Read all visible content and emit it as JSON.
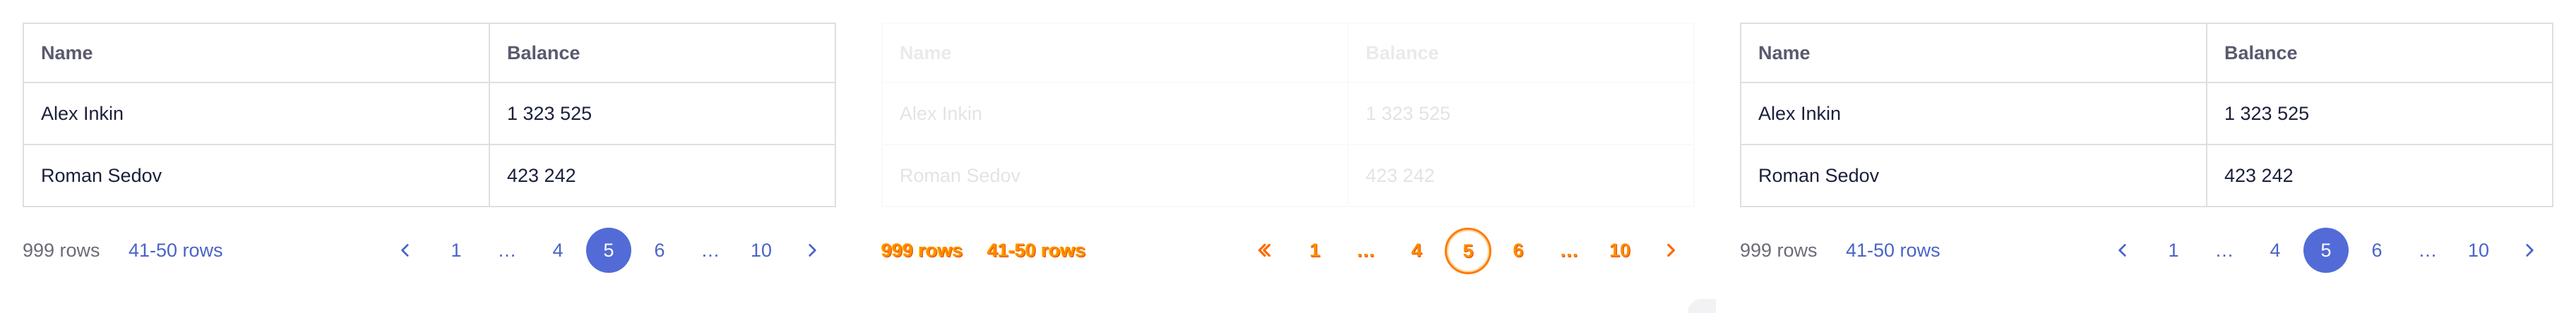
{
  "table": {
    "headers": [
      "Name",
      "Balance"
    ],
    "rows": [
      {
        "name": "Alex Inkin",
        "balance": "1 323 525"
      },
      {
        "name": "Roman Sedov",
        "balance": "423 242"
      }
    ]
  },
  "pagination": {
    "total_rows": "999 rows",
    "range": "41-50 rows",
    "pages": [
      "1",
      "…",
      "4",
      "5",
      "6",
      "…",
      "10"
    ],
    "active_page": "5",
    "prev_icon": "chevron-left-icon",
    "next_icon": "chevron-right-icon"
  },
  "colors": {
    "accent": "#526bd6",
    "link": "#4a63c8",
    "border": "#dedee3",
    "focus_outline": "#ff7a00"
  }
}
